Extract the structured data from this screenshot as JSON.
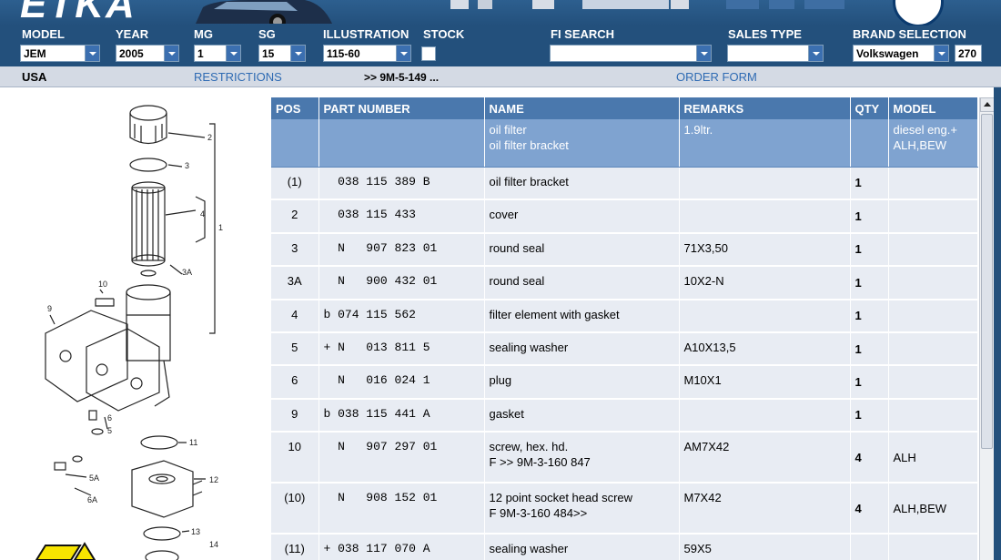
{
  "app": {
    "logo_text": "ETKA"
  },
  "filters": {
    "model": {
      "label": "MODEL",
      "value": "JEM"
    },
    "year": {
      "label": "YEAR",
      "value": "2005"
    },
    "mg": {
      "label": "MG",
      "value": "1"
    },
    "sg": {
      "label": "SG",
      "value": "15"
    },
    "illustration": {
      "label": "ILLUSTRATION",
      "value": "115-60"
    },
    "stock": {
      "label": "STOCK"
    },
    "fi_search": {
      "label": "FI SEARCH",
      "value": ""
    },
    "sales_type": {
      "label": "SALES TYPE",
      "value": ""
    },
    "brand": {
      "label": "BRAND SELECTION",
      "value": "Volkswagen",
      "code": "270"
    }
  },
  "info": {
    "market": "USA",
    "restrictions": "RESTRICTIONS",
    "reference": ">> 9M-5-149 ...",
    "order_form": "ORDER FORM"
  },
  "table": {
    "headers": {
      "pos": "POS",
      "part_number": "PART NUMBER",
      "name": "NAME",
      "remarks": "REMARKS",
      "qty": "QTY",
      "model": "MODEL"
    },
    "group": {
      "name_1": "oil filter",
      "name_2": "oil filter bracket",
      "remarks": "1.9ltr.",
      "model_1": "diesel eng.+",
      "model_2": "ALH,BEW"
    },
    "rows": [
      {
        "pos": "(1)",
        "pn": "  038 115 389 B",
        "name": "oil filter bracket",
        "name2": "",
        "remarks": "",
        "qty": "1",
        "model": ""
      },
      {
        "pos": "2",
        "pn": "  038 115 433",
        "name": "cover",
        "name2": "",
        "remarks": "",
        "qty": "1",
        "model": ""
      },
      {
        "pos": "3",
        "pn": "  N   907 823 01",
        "name": "round seal",
        "name2": "",
        "remarks": "71X3,50",
        "qty": "1",
        "model": ""
      },
      {
        "pos": "3A",
        "pn": "  N   900 432 01",
        "name": "round seal",
        "name2": "",
        "remarks": "10X2-N",
        "qty": "1",
        "model": ""
      },
      {
        "pos": "4",
        "pn": "b 074 115 562",
        "name": "filter element with gasket",
        "name2": "",
        "remarks": "",
        "qty": "1",
        "model": ""
      },
      {
        "pos": "5",
        "pn": "+ N   013 811 5",
        "name": "sealing washer",
        "name2": "",
        "remarks": "A10X13,5",
        "qty": "1",
        "model": ""
      },
      {
        "pos": "6",
        "pn": "  N   016 024 1",
        "name": "plug",
        "name2": "",
        "remarks": "M10X1",
        "qty": "1",
        "model": ""
      },
      {
        "pos": "9",
        "pn": "b 038 115 441 A",
        "name": "gasket",
        "name2": "",
        "remarks": "",
        "qty": "1",
        "model": ""
      },
      {
        "pos": "10",
        "pn": "  N   907 297 01",
        "name": "screw, hex. hd.",
        "name2": "F          >> 9M-3-160 847",
        "remarks": "AM7X42",
        "qty": "4",
        "model": "ALH"
      },
      {
        "pos": "(10)",
        "pn": "  N   908 152 01",
        "name": "12 point socket head screw",
        "name2": "F 9M-3-160 484>>",
        "remarks": "M7X42",
        "qty": "4",
        "model": "ALH,BEW"
      },
      {
        "pos": "(11)",
        "pn": "+ 038 117 070 A",
        "name": "sealing washer",
        "name2": "",
        "remarks": "59X5",
        "qty": "",
        "model": ""
      }
    ]
  },
  "illustration_labels": [
    "2",
    "3",
    "4",
    "1",
    "3A",
    "10",
    "9",
    "6",
    "5",
    "11",
    "12",
    "5A",
    "6A",
    "13",
    "14"
  ],
  "colors": {
    "header_blue": "#23507c",
    "table_header": "#4a78ad",
    "group_row": "#7fa3d0",
    "row_bg": "#e8ecf3"
  }
}
